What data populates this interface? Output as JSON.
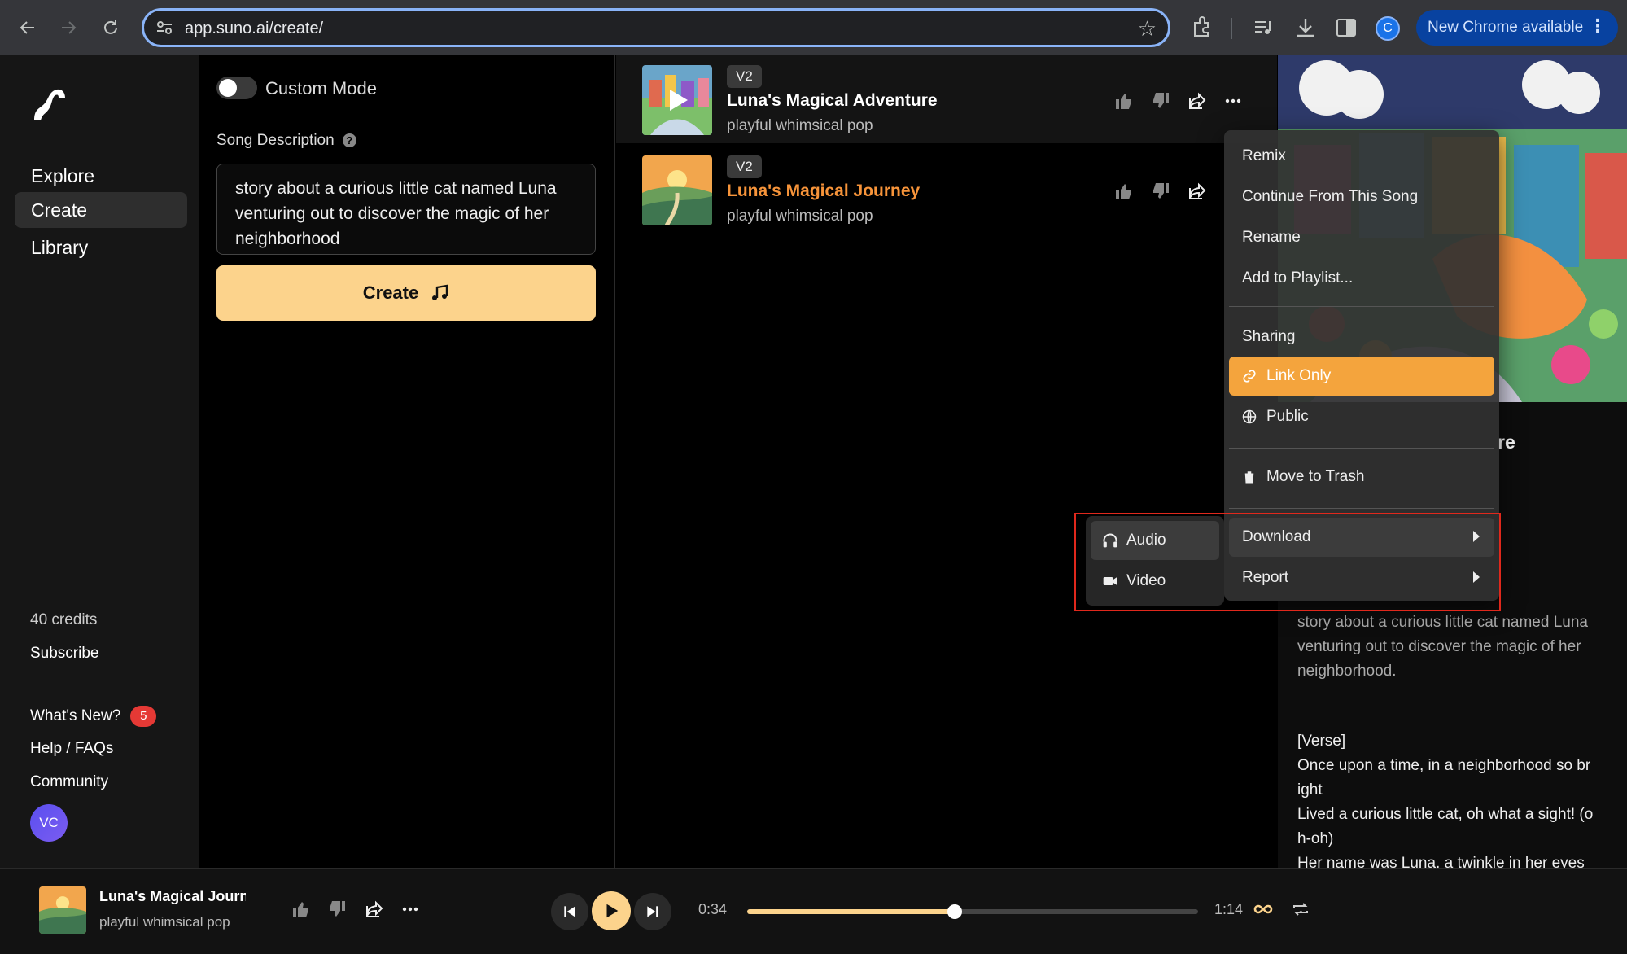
{
  "browser": {
    "url": "app.suno.ai/create/",
    "update_label": "New Chrome available",
    "profile_initial": "C"
  },
  "sidebar": {
    "nav": [
      {
        "label": "Explore"
      },
      {
        "label": "Create"
      },
      {
        "label": "Library"
      }
    ],
    "credits": "40 credits",
    "subscribe": "Subscribe",
    "whats_new": "What's New?",
    "whats_new_count": "5",
    "help": "Help / FAQs",
    "community": "Community",
    "avatar_initials": "VC"
  },
  "create": {
    "custom_mode_label": "Custom Mode",
    "custom_mode_on": false,
    "description_label": "Song Description",
    "description_value": "story about a curious little cat named Luna venturing out to discover the magic of her neighborhood",
    "create_label": "Create"
  },
  "songs": [
    {
      "version": "V2",
      "title": "Luna's Magical Adventure",
      "style": "playful whimsical pop"
    },
    {
      "version": "V2",
      "title": "Luna's Magical Journey",
      "style": "playful whimsical pop"
    }
  ],
  "detail": {
    "title_fragment": "re",
    "description": "story about a curious little cat named Luna venturing out to discover the magic of her neighborhood.",
    "lyrics": "[Verse]\nOnce upon a time, in a neighborhood so br\night\nLived a curious little cat, oh what a sight! (o\nh-oh)\nHer name was Luna, a twinkle in her eyes"
  },
  "menu": {
    "items": [
      {
        "label": "Remix"
      },
      {
        "label": "Continue From This Song"
      },
      {
        "label": "Rename"
      },
      {
        "label": "Add to Playlist..."
      }
    ],
    "sharing_header": "Sharing",
    "sharing": [
      {
        "label": "Link Only",
        "icon": "link-icon"
      },
      {
        "label": "Public",
        "icon": "globe-icon"
      }
    ],
    "trash": "Move to Trash",
    "download": "Download",
    "report": "Report",
    "download_options": [
      {
        "label": "Audio",
        "icon": "headphones-icon"
      },
      {
        "label": "Video",
        "icon": "video-icon"
      }
    ]
  },
  "player": {
    "title": "Luna's Magical Journ",
    "style": "playful whimsical pop",
    "current_time": "0:34",
    "total_time": "1:14",
    "progress": 0.46
  },
  "colors": {
    "accent": "#fcd38c",
    "highlight_orange": "#f4a43d",
    "title_orange": "#f7943a",
    "annotation_red": "#e0281c"
  }
}
